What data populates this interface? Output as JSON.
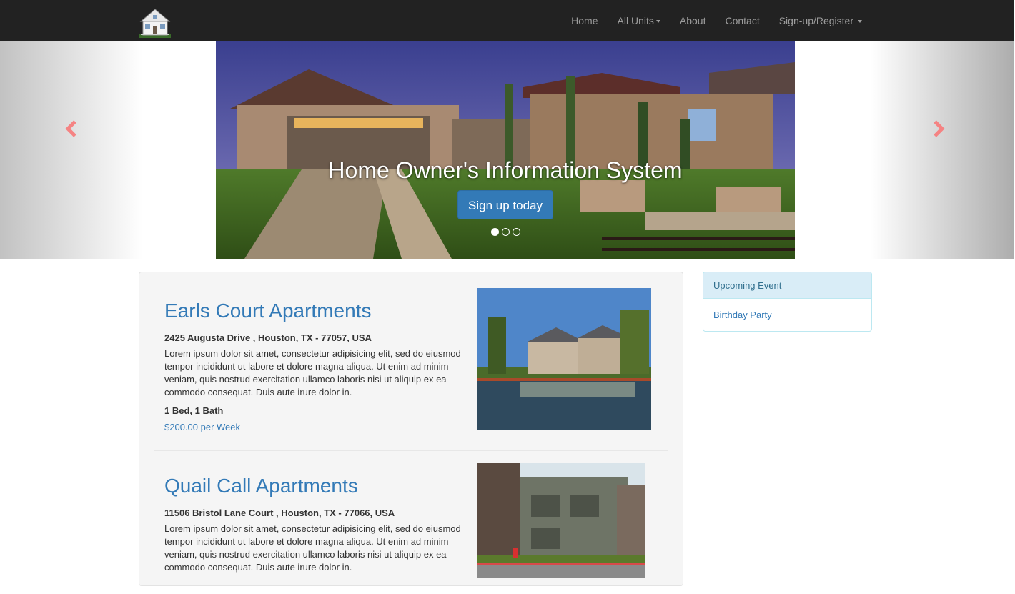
{
  "navbar": {
    "brand_icon": "house-icon",
    "items": [
      {
        "label": "Home"
      },
      {
        "label": "All Units"
      },
      {
        "label": "About"
      },
      {
        "label": "Contact"
      },
      {
        "label": "Sign-up/Register"
      }
    ]
  },
  "carousel": {
    "title": "Home Owner's Information System",
    "button": "Sign up today",
    "slide_count": 3,
    "active_slide": 1,
    "prev_icon": "chevron-left-icon",
    "next_icon": "chevron-right-icon",
    "control_color": "#f58383"
  },
  "listings": [
    {
      "name": "Earls Court Apartments",
      "address": "2425 Augusta Drive , Houston, TX - 77057, USA",
      "description": "Lorem ipsum dolor sit amet, consectetur adipisicing elit, sed do eiusmod tempor incididunt ut labore et dolore magna aliqua. Ut enim ad minim veniam, quis nostrud exercitation ullamco laboris nisi ut aliquip ex ea commodo consequat. Duis aute irure dolor in.",
      "beds": "1 Bed, 1 Bath",
      "price": "$200.00 per Week"
    },
    {
      "name": "Quail Call Apartments",
      "address": "11506 Bristol Lane Court , Houston, TX - 77066, USA",
      "description": "Lorem ipsum dolor sit amet, consectetur adipisicing elit, sed do eiusmod tempor incididunt ut labore et dolore magna aliqua. Ut enim ad minim veniam, quis nostrud exercitation ullamco laboris nisi ut aliquip ex ea commodo consequat. Duis aute irure dolor in."
    }
  ],
  "sidebar": {
    "heading": "Upcoming Event",
    "events": [
      {
        "label": "Birthday Party"
      }
    ]
  },
  "colors": {
    "navbar_bg": "#222222",
    "link": "#337ab7",
    "button": "#337ab7",
    "panel_head_bg": "#d9edf7"
  }
}
